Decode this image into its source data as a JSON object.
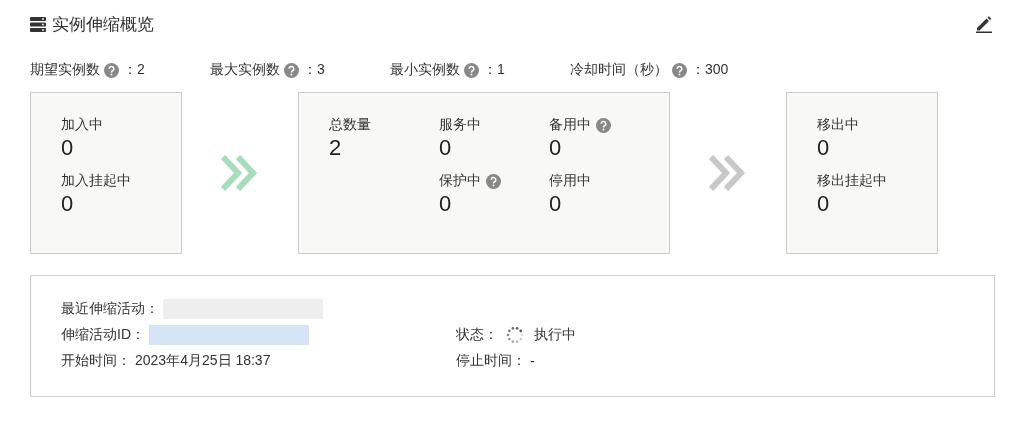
{
  "header": {
    "title": "实例伸缩概览"
  },
  "settings": [
    {
      "label": "期望实例数",
      "help": true,
      "value": "：2"
    },
    {
      "label": "最大实例数",
      "help": true,
      "value": "：3"
    },
    {
      "label": "最小实例数",
      "help": true,
      "value": "：1"
    },
    {
      "label": "冷却时间（秒）",
      "help": true,
      "value": "：300"
    }
  ],
  "flow": [
    {
      "kind": "card",
      "columns": [
        [
          {
            "label": "加入中",
            "help": false,
            "value": "0"
          },
          {
            "label": "加入挂起中",
            "help": false,
            "value": "0"
          }
        ]
      ]
    },
    {
      "kind": "arrow",
      "active": true
    },
    {
      "kind": "card",
      "columns": [
        [
          {
            "label": "总数量",
            "help": false,
            "value": "2"
          }
        ],
        [
          {
            "label": "服务中",
            "help": false,
            "value": "0"
          },
          {
            "label": "保护中",
            "help": true,
            "value": "0"
          }
        ],
        [
          {
            "label": "备用中",
            "help": true,
            "value": "0"
          },
          {
            "label": "停用中",
            "help": false,
            "value": "0"
          }
        ]
      ]
    },
    {
      "kind": "arrow",
      "active": false
    },
    {
      "kind": "card",
      "columns": [
        [
          {
            "label": "移出中",
            "help": false,
            "value": "0"
          },
          {
            "label": "移出挂起中",
            "help": false,
            "value": "0"
          }
        ]
      ]
    }
  ],
  "activity": {
    "rows": [
      {
        "left": {
          "label": "最近伸缩活动：",
          "color": "#eeeeee"
        }
      },
      {
        "left": {
          "label": "伸缩活动ID：",
          "color": "#d6e5f5"
        },
        "right": {
          "label": "状态：",
          "spinner": true,
          "value": "执行中"
        }
      },
      {
        "left": {
          "label": "开始时间：",
          "value": "2023年4月25日 18:37"
        },
        "right": {
          "label": "停止时间：",
          "value": "-"
        }
      }
    ]
  }
}
